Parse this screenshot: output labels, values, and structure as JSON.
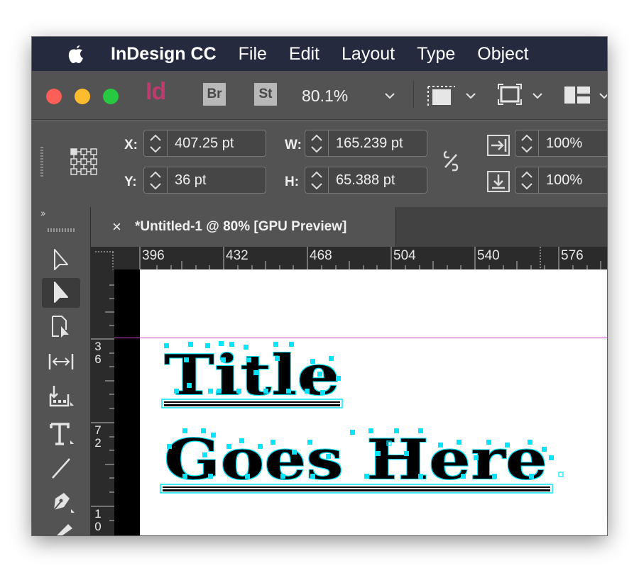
{
  "menubar": {
    "app_name": "InDesign CC",
    "items": [
      "File",
      "Edit",
      "Layout",
      "Type",
      "Object"
    ]
  },
  "appbar": {
    "id_logo": "Id",
    "bridge_label": "Br",
    "stock_label": "St",
    "zoom_level": "80.1%"
  },
  "control": {
    "x_label": "X:",
    "x_value": "407.25 pt",
    "y_label": "Y:",
    "y_value": "36 pt",
    "w_label": "W:",
    "w_value": "165.239 pt",
    "h_label": "H:",
    "h_value": "65.388 pt",
    "scale_x_value": "100%",
    "scale_y_value": "100%"
  },
  "tools_panel": {
    "collapse_glyph": "››"
  },
  "document_tab": {
    "close_glyph": "×",
    "title": "*Untitled-1 @ 80% [GPU Preview]"
  },
  "ruler": {
    "horizontal_labels": [
      "396",
      "432",
      "468",
      "504",
      "540",
      "576"
    ],
    "vertical_labels": [
      [
        "3",
        "6"
      ],
      [
        "7",
        "2"
      ],
      [
        "1",
        "0"
      ]
    ]
  },
  "canvas": {
    "line1": "Title",
    "line2": "Goes Here"
  },
  "colors": {
    "menubar_bg": "#262a3f",
    "panel_bg": "#535353",
    "indesign_pink": "#bf3a6f",
    "guide_magenta": "#d23bd2",
    "selection_cyan": "#00e5ff"
  }
}
